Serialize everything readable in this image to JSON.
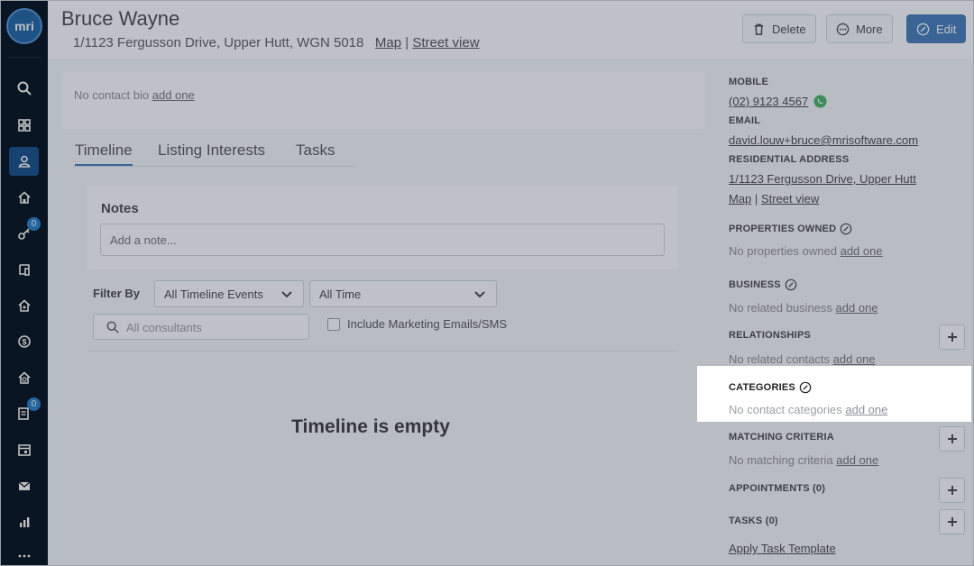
{
  "app": {
    "logo_text": "mri"
  },
  "sidebar": {
    "items": [
      {
        "icon": "search-icon"
      },
      {
        "icon": "dashboard-icon"
      },
      {
        "icon": "contact-icon"
      },
      {
        "icon": "home-icon"
      },
      {
        "icon": "key-icon",
        "badge": "0"
      },
      {
        "icon": "clipboard-icon"
      },
      {
        "icon": "house-icon"
      },
      {
        "icon": "dollar-icon"
      },
      {
        "icon": "house-star-icon"
      },
      {
        "icon": "list-icon",
        "badge": "0"
      },
      {
        "icon": "calendar-icon"
      },
      {
        "icon": "mail-icon"
      },
      {
        "icon": "chart-icon"
      },
      {
        "icon": "more-icon"
      }
    ]
  },
  "header": {
    "name": "Bruce Wayne",
    "address": "1/1123 Fergusson Drive, Upper Hutt, WGN 5018",
    "map_link": "Map",
    "separator": "|",
    "street_view_link": "Street view",
    "delete_label": "Delete",
    "more_label": "More",
    "edit_label": "Edit"
  },
  "bio": {
    "text": "No contact bio",
    "add_link": "add one"
  },
  "tabs": [
    {
      "label": "Timeline",
      "active": true
    },
    {
      "label": "Listing Interests",
      "active": false
    },
    {
      "label": "Tasks",
      "active": false
    }
  ],
  "notes": {
    "title": "Notes",
    "placeholder": "Add a note..."
  },
  "filter": {
    "label": "Filter By",
    "events_select": "All Timeline Events",
    "time_select": "All Time",
    "consultants_placeholder": "All consultants",
    "marketing_checkbox": "Include Marketing Emails/SMS"
  },
  "timeline": {
    "empty_message": "Timeline is empty"
  },
  "details": {
    "mobile_label": "MOBILE",
    "mobile_value": "(02) 9123 4567",
    "email_label": "EMAIL",
    "email_value": "david.louw+bruce@mrisoftware.com",
    "residential_label": "RESIDENTIAL ADDRESS",
    "residential_value": "1/1123 Fergusson Drive, Upper Hutt",
    "map_link": "Map",
    "separator": "|",
    "street_view_link": "Street view",
    "properties_label": "PROPERTIES OWNED",
    "properties_text": "No properties owned",
    "business_label": "BUSINESS",
    "business_text": "No related business",
    "relationships_label": "RELATIONSHIPS",
    "relationships_text": "No related contacts",
    "categories_label": "CATEGORIES",
    "categories_text": "No contact categories",
    "matching_label": "MATCHING CRITERIA",
    "matching_text": "No matching criteria",
    "appointments_label": "APPOINTMENTS (0)",
    "tasks_label": "TASKS (0)",
    "apply_task_template": "Apply Task Template",
    "add_one": "add one"
  },
  "colors": {
    "sidebar": "#0c1c2e",
    "primary": "#1d5ea8",
    "active_nav": "#1e5a99",
    "whatsapp": "#25a244"
  }
}
